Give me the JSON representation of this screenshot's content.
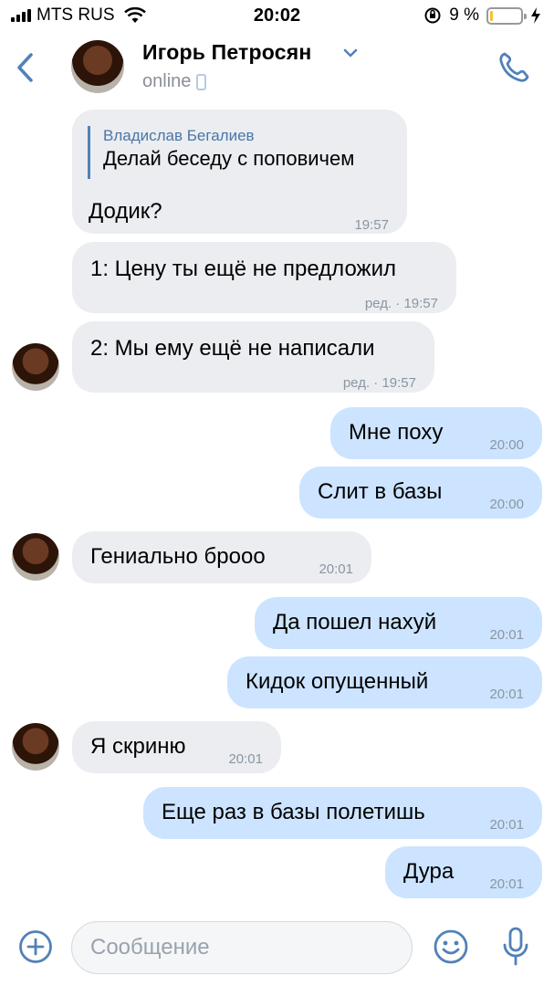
{
  "status_bar": {
    "carrier": "MTS RUS",
    "time": "20:02",
    "battery_percent": "9 %",
    "battery_level": 0.09
  },
  "header": {
    "name": "Игорь Петросян",
    "status": "online",
    "accent": "#4a76a8"
  },
  "messages": [
    {
      "direction": "in",
      "reply": {
        "author": "Владислав Бегалиев",
        "text": "Делай беседу с поповичем"
      },
      "text": "Додик?",
      "time": "19:57"
    },
    {
      "direction": "in",
      "text": "1: Цену ты ещё не предложил",
      "time": "ред. · 19:57"
    },
    {
      "direction": "in",
      "text": "2: Мы ему ещё не написали",
      "time": "ред. · 19:57",
      "avatar": true
    },
    {
      "direction": "out",
      "text": "Мне поху",
      "time": "20:00"
    },
    {
      "direction": "out",
      "text": "Слит в базы",
      "time": "20:00"
    },
    {
      "direction": "in",
      "text": "Гениально брооо",
      "time": "20:01",
      "avatar": true
    },
    {
      "direction": "out",
      "text": "Да пошел нахуй",
      "time": "20:01"
    },
    {
      "direction": "out",
      "text": "Кидок опущенный",
      "time": "20:01"
    },
    {
      "direction": "in",
      "text": "Я скриню",
      "time": "20:01",
      "avatar": true
    },
    {
      "direction": "out",
      "text": "Еще раз в базы полетишь",
      "time": "20:01"
    },
    {
      "direction": "out",
      "text": "Дура",
      "time": "20:01"
    }
  ],
  "composer": {
    "placeholder": "Сообщение"
  },
  "colors": {
    "incoming_bubble": "#ebedf0",
    "outgoing_bubble": "#cce4ff",
    "icon_blue": "#5181b8"
  }
}
